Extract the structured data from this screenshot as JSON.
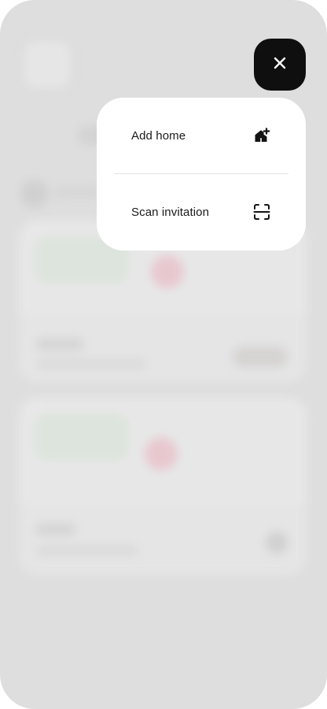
{
  "close_button": {
    "icon": "close-icon"
  },
  "menu": {
    "items": [
      {
        "label": "Add home",
        "icon": "house-add-icon"
      },
      {
        "label": "Scan invitation",
        "icon": "scan-frame-icon"
      }
    ]
  },
  "colors": {
    "overlay": "#dedede",
    "close_bg": "#0f0f0f",
    "menu_bg": "#ffffff",
    "text": "#1a1a1a"
  }
}
